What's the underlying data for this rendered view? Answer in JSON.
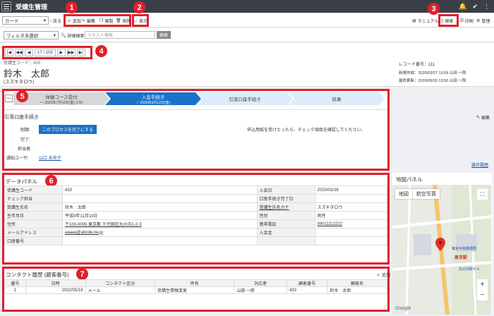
{
  "app": {
    "title": "受講生管理"
  },
  "toolbar": {
    "view_select": "カード",
    "back_label": "戻る",
    "add_label": "追加",
    "edit_label": "編集",
    "copy_label": "複製",
    "delete_label": "削除",
    "view_label": "表示",
    "manual_label": "マニュアル",
    "search_label": "検索",
    "print_label": "印刷",
    "manage_label": "管理"
  },
  "filter": {
    "select": "フィルタ未選択",
    "detail_search": "詳細検索",
    "text_placeholder": "テキスト検索",
    "search_button": "検索"
  },
  "pager": {
    "count": "17 / 103"
  },
  "record": {
    "code_line": "受講生コード：433",
    "name": "鈴木　太郎",
    "kana": "(スズキタロウ)",
    "record_no": "レコード番号：111",
    "created": "新規作成：2020/03/27 13:59 山田 一郎",
    "updated": "最終更新：2020/05/20 13:50 山田 一郎"
  },
  "process": {
    "collapse": "－",
    "steps": [
      {
        "label": "体験コース受付",
        "sub": "～ 2020年7月10日(金) 2:00"
      },
      {
        "label": "入会手続き",
        "sub": "✓ 2020年6月12日(金)"
      },
      {
        "label": "引落口座手続き",
        "sub": ""
      },
      {
        "label": "結果",
        "sub": ""
      }
    ],
    "section_title": "引落口座手続き",
    "edit_label": "編集",
    "status_label": "制御:",
    "complete_button": "このプロセスを完了にする",
    "done_label": "完了:",
    "owner_label": "担当者:",
    "notify_label": "通知ユーザ:",
    "notify_user": "山口 未央子",
    "instruction": "申込用紙を受けとったら、チェック項目を確認してください。",
    "history_link": "操作履歴"
  },
  "badges": {
    "b1": "1",
    "b2": "2",
    "b3": "3",
    "b4": "4",
    "b5": "5",
    "b6": "6",
    "b7": "7"
  },
  "datapanel": {
    "title": "データパネル",
    "rows": [
      {
        "k1": "受講生コード",
        "v1": "433",
        "k2": "入会日",
        "v2": "2020/03/26"
      },
      {
        "k1": "チェック担当",
        "v1": "",
        "k2": "口座手続き完了日",
        "v2": ""
      },
      {
        "k1": "受講生氏名",
        "v1": "鈴木　太郎",
        "k2": "受講生氏名カナ",
        "v2": "スズキタロウ"
      },
      {
        "k1": "生年月日",
        "v1": "平成9年11月13日",
        "k2": "性別",
        "v2": "男性"
      },
      {
        "k1": "住所",
        "v1": "〒100-0005 東京都 千代田区丸の内1-2-3",
        "k2": "携帯電話",
        "v2": "08011112222"
      },
      {
        "k1": "メールアドレス",
        "v1": "aaaaa@abcde.ne.jp",
        "k2": "入会金",
        "v2": ""
      },
      {
        "k1": "口座番号",
        "v1": "",
        "k2": "",
        "v2": ""
      }
    ]
  },
  "contact": {
    "title": "コンタクト履歴 (顧客番号)",
    "add_label": "追加",
    "headers": [
      "番号",
      "日時",
      "コンタクト区分",
      "件名",
      "対応者",
      "顧客番号",
      "顧客名"
    ],
    "rows": [
      [
        "1",
        "2022/05/18",
        "メール",
        "受講生情報変更",
        "山田 一郎",
        "433",
        "鈴木　太郎"
      ]
    ]
  },
  "map": {
    "title": "地図パネル",
    "tab_map": "地図",
    "tab_sat": "航空写真",
    "station1": "東京駅",
    "station2": "東京中央郵便局",
    "station3": "丸の内駅ビル",
    "zoom_in": "+",
    "zoom_out": "−",
    "brand": "Google"
  }
}
